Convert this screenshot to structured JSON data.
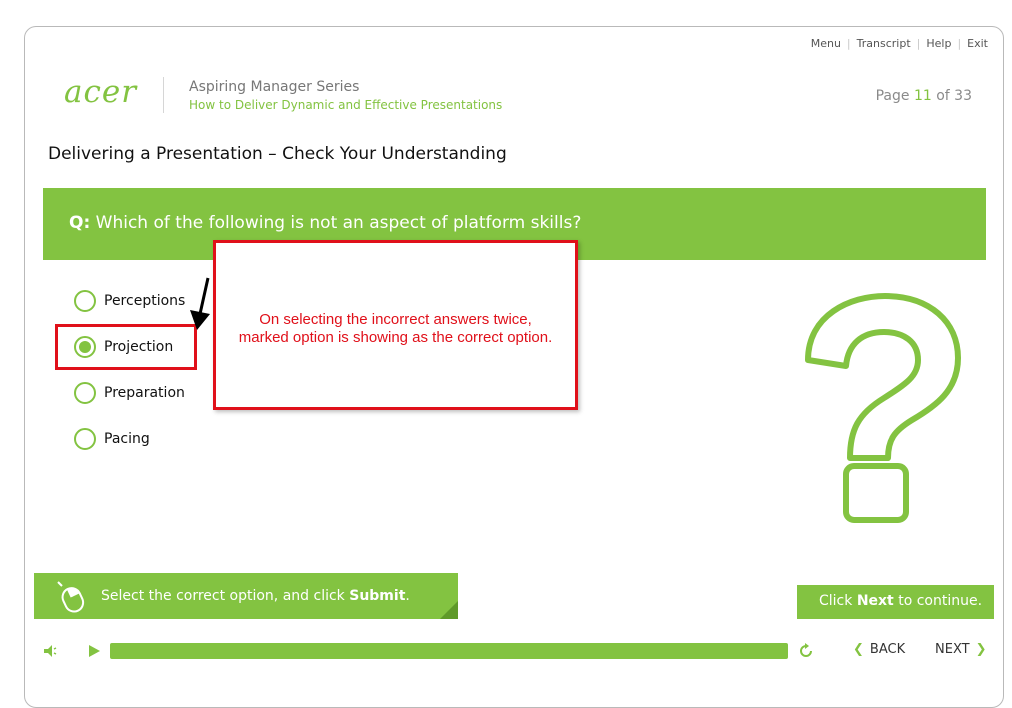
{
  "colors": {
    "accent": "#83c341",
    "annotation_red": "#e0101a"
  },
  "topnav": {
    "menu": "Menu",
    "transcript": "Transcript",
    "help": "Help",
    "exit": "Exit",
    "separator": "|"
  },
  "logo": {
    "text": "acer"
  },
  "header": {
    "series": "Aspiring Manager Series",
    "course": "How to Deliver Dynamic and Effective Presentations",
    "page_label": "Page",
    "page_current": "11",
    "page_of": "of",
    "page_total": "33"
  },
  "page_title": "Delivering a Presentation – Check Your Understanding",
  "question": {
    "prefix": "Q:",
    "text": "Which of the following is not an aspect of platform skills?"
  },
  "options": [
    {
      "label": "Perceptions",
      "selected": false
    },
    {
      "label": "Projection",
      "selected": true
    },
    {
      "label": "Preparation",
      "selected": false
    },
    {
      "label": "Pacing",
      "selected": false
    }
  ],
  "annotation": {
    "line1": "On selecting the incorrect answers twice,",
    "line2": "marked option is showing as the correct option."
  },
  "instruction": {
    "text_before": "Select the correct option, and click ",
    "bold": "Submit",
    "text_after": "."
  },
  "continue_msg": {
    "before": "Click ",
    "bold": "Next",
    "after": " to continue."
  },
  "player": {
    "icons": [
      "volume-icon",
      "play-icon",
      "replay-icon"
    ],
    "progress": 1.0,
    "back_label": "BACK",
    "next_label": "NEXT"
  }
}
